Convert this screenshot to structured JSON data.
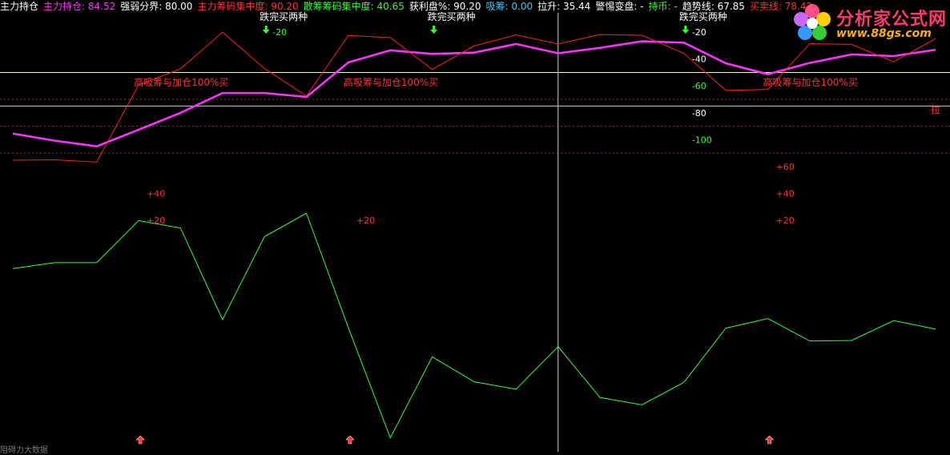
{
  "header": {
    "items": [
      {
        "label": "主力持仓",
        "value": "",
        "color": "#ffffff"
      },
      {
        "label": "主力持仓:",
        "value": "84.52",
        "color": "#ff33ff"
      },
      {
        "label": "强弱分界:",
        "value": "80.00",
        "color": "#ffffff"
      },
      {
        "label": "主力筹码集中度:",
        "value": "90.20",
        "color": "#ff3333"
      },
      {
        "label": "散筹筹码集中度:",
        "value": "40.65",
        "color": "#33ff33"
      },
      {
        "label": "获利盘%:",
        "value": "90.20",
        "color": "#ffffff"
      },
      {
        "label": "吸筹:",
        "value": "0.00",
        "color": "#33ccff"
      },
      {
        "label": "拉升:",
        "value": "35.44",
        "color": "#ffffff"
      },
      {
        "label": "警惕变盘:",
        "value": "-",
        "color": "#ffffff"
      },
      {
        "label": "持币:",
        "value": "-",
        "color": "#33ff33"
      },
      {
        "label": "趋势线:",
        "value": "67.85",
        "color": "#ffffff"
      },
      {
        "label": "买卖线:",
        "value": "78.42",
        "color": "#ff3333"
      }
    ]
  },
  "logo": {
    "title": "分析家公式网",
    "url": "www.88gs.com"
  },
  "bottom_text": "阻碍力大数据",
  "chart_data": {
    "type": "line",
    "x": [
      0,
      1,
      2,
      3,
      4,
      5,
      6,
      7,
      8,
      9,
      10,
      11,
      12,
      13,
      14,
      15,
      16,
      17,
      18,
      19,
      20,
      21,
      22
    ],
    "series": [
      {
        "name": "主力持仓",
        "color": "#ff33ff",
        "values": [
          34.5,
          29.2,
          25.0,
          37.4,
          50.0,
          64.7,
          64.7,
          61.8,
          87.5,
          96.5,
          93.8,
          94.8,
          101.2,
          94.3,
          98.3,
          103.2,
          102.2,
          86.8,
          78.7,
          87.1,
          93.4,
          92.2,
          96.9
        ]
      },
      {
        "name": "主力筹码集中度",
        "color": "#ff2222",
        "values": [
          14.7,
          15.0,
          13.3,
          70.8,
          82.7,
          110.0,
          82.9,
          62.5,
          107.5,
          106.0,
          82.3,
          99.8,
          107.9,
          101.2,
          108.2,
          107.7,
          94.2,
          66.6,
          67.4,
          101.4,
          100.9,
          87.9,
          105.2
        ]
      },
      {
        "name": "散筹筹码集中度",
        "color": "#33ff33",
        "values": [
          -66.0,
          -61.6,
          -61.6,
          -30.3,
          -35.8,
          -104.0,
          -42.2,
          -24.8,
          -110.0,
          -192.0,
          -131.7,
          -150.3,
          -155.8,
          -124.1,
          -162.0,
          -167.4,
          -150.7,
          -110.3,
          -103.2,
          -119.9,
          -119.5,
          -104.7,
          -111.1
        ]
      }
    ],
    "reference_lines": [
      {
        "name": "强弱分界",
        "value": 80.0,
        "color": "#ffffaa"
      },
      {
        "name": "hline-2",
        "value": 55.0,
        "color": "#cccccc"
      }
    ],
    "dotted_levels": [
      {
        "value": 80.0,
        "color": "#993333"
      },
      {
        "value": 60.0,
        "color": "#993333"
      },
      {
        "value": 40.0,
        "color": "#993333"
      },
      {
        "value": 20.0,
        "color": "#993333"
      }
    ],
    "annotations": [
      {
        "text": "高吸筹与加仓100%买",
        "x": 3,
        "y": 70,
        "color": "#ff3333"
      },
      {
        "text": "高吸筹与加仓100%买",
        "x": 8,
        "y": 70,
        "color": "#ff3333"
      },
      {
        "text": "高吸筹与加仓100%买",
        "x": 18,
        "y": 70,
        "color": "#ff3333"
      },
      {
        "text": "跌完买两种",
        "x": 6,
        "y": 119,
        "color": "#ffffff"
      },
      {
        "text": "跌完买两种",
        "x": 10,
        "y": 119,
        "color": "#ffffff"
      },
      {
        "text": "跌完买两种",
        "x": 16,
        "y": 119,
        "color": "#ffffff"
      },
      {
        "text": "拉",
        "x": 22,
        "y": 50,
        "color": "#ff3333"
      }
    ],
    "level_labels": [
      {
        "text": "-20",
        "x": 6,
        "y": 110,
        "color": "#33ff33"
      },
      {
        "text": "-20",
        "x": 16,
        "y": 110,
        "color": "#ffffff"
      },
      {
        "text": "-40",
        "x": 16,
        "y": 90,
        "color": "#ffffff"
      },
      {
        "text": "-60",
        "x": 16,
        "y": 70,
        "color": "#33ff33"
      },
      {
        "text": "-80",
        "x": 16,
        "y": 50,
        "color": "#ffffff"
      },
      {
        "text": "-100",
        "x": 16,
        "y": 30,
        "color": "#33ff33"
      },
      {
        "text": "+60",
        "x": 18,
        "y": 10,
        "color": "#ff3333"
      },
      {
        "text": "+40",
        "x": 3,
        "y": -10,
        "color": "#ff3333"
      },
      {
        "text": "+40",
        "x": 18,
        "y": -10,
        "color": "#ff3333"
      },
      {
        "text": "+20",
        "x": 3,
        "y": -30,
        "color": "#ff3333"
      },
      {
        "text": "+20",
        "x": 8,
        "y": -30,
        "color": "#ff3333"
      },
      {
        "text": "+20",
        "x": 18,
        "y": -30,
        "color": "#ff3333"
      }
    ],
    "down_arrows": [
      6,
      10,
      16
    ],
    "up_arrows": [
      3,
      8,
      18
    ],
    "vertical_line_x": 13,
    "ylim": [
      -200,
      125
    ],
    "xlim": [
      0,
      22.4
    ]
  }
}
